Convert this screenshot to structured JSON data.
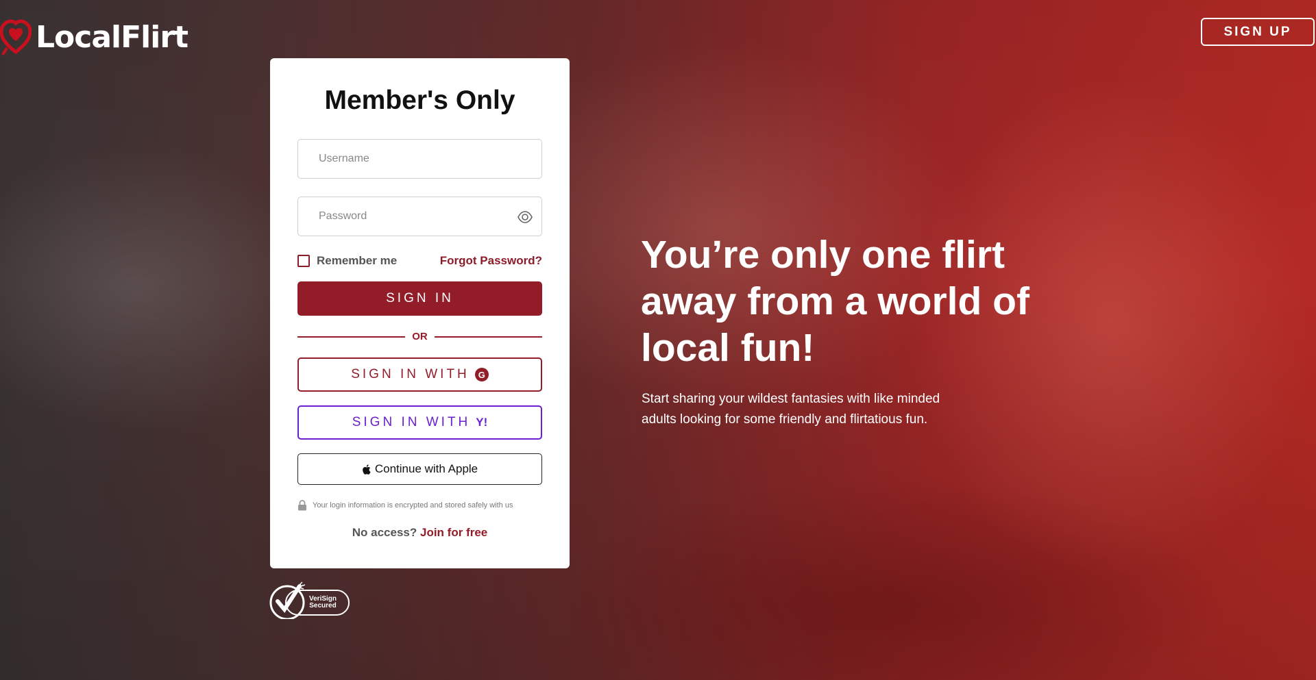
{
  "brand": {
    "name": "LocalFlirt"
  },
  "header": {
    "signup_label": "SIGN UP"
  },
  "login": {
    "title": "Member's Only",
    "username_placeholder": "Username",
    "password_placeholder": "Password",
    "remember_label": "Remember me",
    "forgot_label": "Forgot Password?",
    "signin_label": "SIGN IN",
    "or_label": "OR",
    "google_label": "SIGN IN WITH",
    "google_badge": "G",
    "yahoo_label": "SIGN IN WITH",
    "yahoo_badge": "Y!",
    "apple_label": "Continue with Apple",
    "secure_note": "Your login information is encrypted and stored safely with us",
    "no_access_label": "No access?",
    "join_label": "Join for free"
  },
  "badge": {
    "line1": "VeriSign",
    "line2": "Secured"
  },
  "hero": {
    "title": "You’re only one flirt away from a world of local fun!",
    "subtitle": "Start sharing your wildest fantasies with like minded adults looking for some friendly and flirtatious fun."
  },
  "colors": {
    "brand_red": "#931c29",
    "yahoo_purple": "#6a1fd1"
  }
}
